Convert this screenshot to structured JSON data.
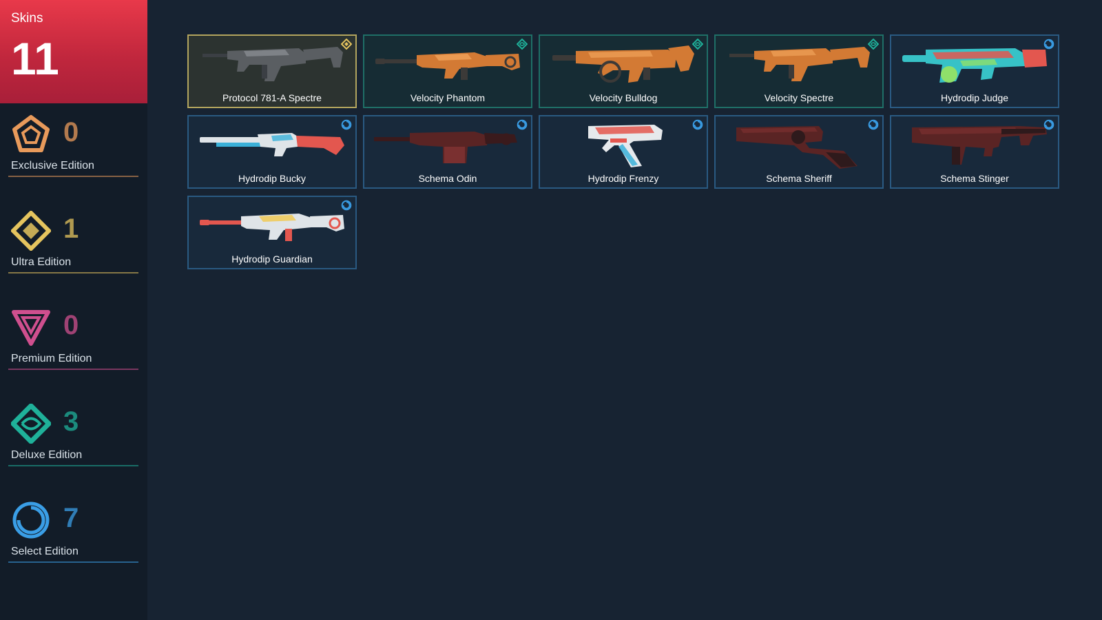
{
  "colors": {
    "exclusive": "#e89a5b",
    "ultra": "#e5c45e",
    "premium": "#cf4f8e",
    "deluxe": "#1fb19a",
    "select": "#3a9ee6",
    "total_card": "#c8283f"
  },
  "total": {
    "label": "Skins",
    "count": "11"
  },
  "tiers": [
    {
      "label": "Exclusive Edition",
      "count": "0",
      "icon": "exclusive-edition-icon"
    },
    {
      "label": "Ultra Edition",
      "count": "1",
      "icon": "ultra-edition-icon"
    },
    {
      "label": "Premium Edition",
      "count": "0",
      "icon": "premium-edition-icon"
    },
    {
      "label": "Deluxe Edition",
      "count": "3",
      "icon": "deluxe-edition-icon"
    },
    {
      "label": "Select Edition",
      "count": "7",
      "icon": "select-edition-icon"
    }
  ],
  "skins": [
    {
      "name": "Protocol 781-A Spectre",
      "tier": "ultra",
      "gun": "smg",
      "palette": [
        "#5a5e62",
        "#3b3f44",
        "#8d9297"
      ]
    },
    {
      "name": "Velocity Phantom",
      "tier": "deluxe",
      "gun": "rifle",
      "palette": [
        "#d37a34",
        "#3c3a38",
        "#f0a35a"
      ]
    },
    {
      "name": "Velocity Bulldog",
      "tier": "deluxe",
      "gun": "bulldog",
      "palette": [
        "#d37a34",
        "#3c3a38",
        "#f0a35a"
      ]
    },
    {
      "name": "Velocity Spectre",
      "tier": "deluxe",
      "gun": "smg",
      "palette": [
        "#d37a34",
        "#3c3a38",
        "#f0a35a"
      ]
    },
    {
      "name": "Hydrodip Judge",
      "tier": "select",
      "gun": "judge",
      "palette": [
        "#37c2c7",
        "#e3574f",
        "#8fe06a"
      ]
    },
    {
      "name": "Hydrodip Bucky",
      "tier": "select",
      "gun": "shotgun",
      "palette": [
        "#dfe4e8",
        "#e3574f",
        "#3ab0d8"
      ]
    },
    {
      "name": "Schema Odin",
      "tier": "select",
      "gun": "odin",
      "palette": [
        "#5a2424",
        "#3a1a1c",
        "#7a3030"
      ]
    },
    {
      "name": "Hydrodip Frenzy",
      "tier": "select",
      "gun": "pistol",
      "palette": [
        "#e6e9ec",
        "#e3574f",
        "#3ab0d8"
      ]
    },
    {
      "name": "Schema Sheriff",
      "tier": "select",
      "gun": "revolver",
      "palette": [
        "#5a2424",
        "#2e1a1c",
        "#7a3030"
      ]
    },
    {
      "name": "Schema Stinger",
      "tier": "select",
      "gun": "stinger",
      "palette": [
        "#5a2424",
        "#2e1a1c",
        "#7a3030"
      ]
    },
    {
      "name": "Hydrodip Guardian",
      "tier": "select",
      "gun": "rifle",
      "palette": [
        "#dfe4e8",
        "#e3574f",
        "#f1c84b"
      ]
    }
  ]
}
